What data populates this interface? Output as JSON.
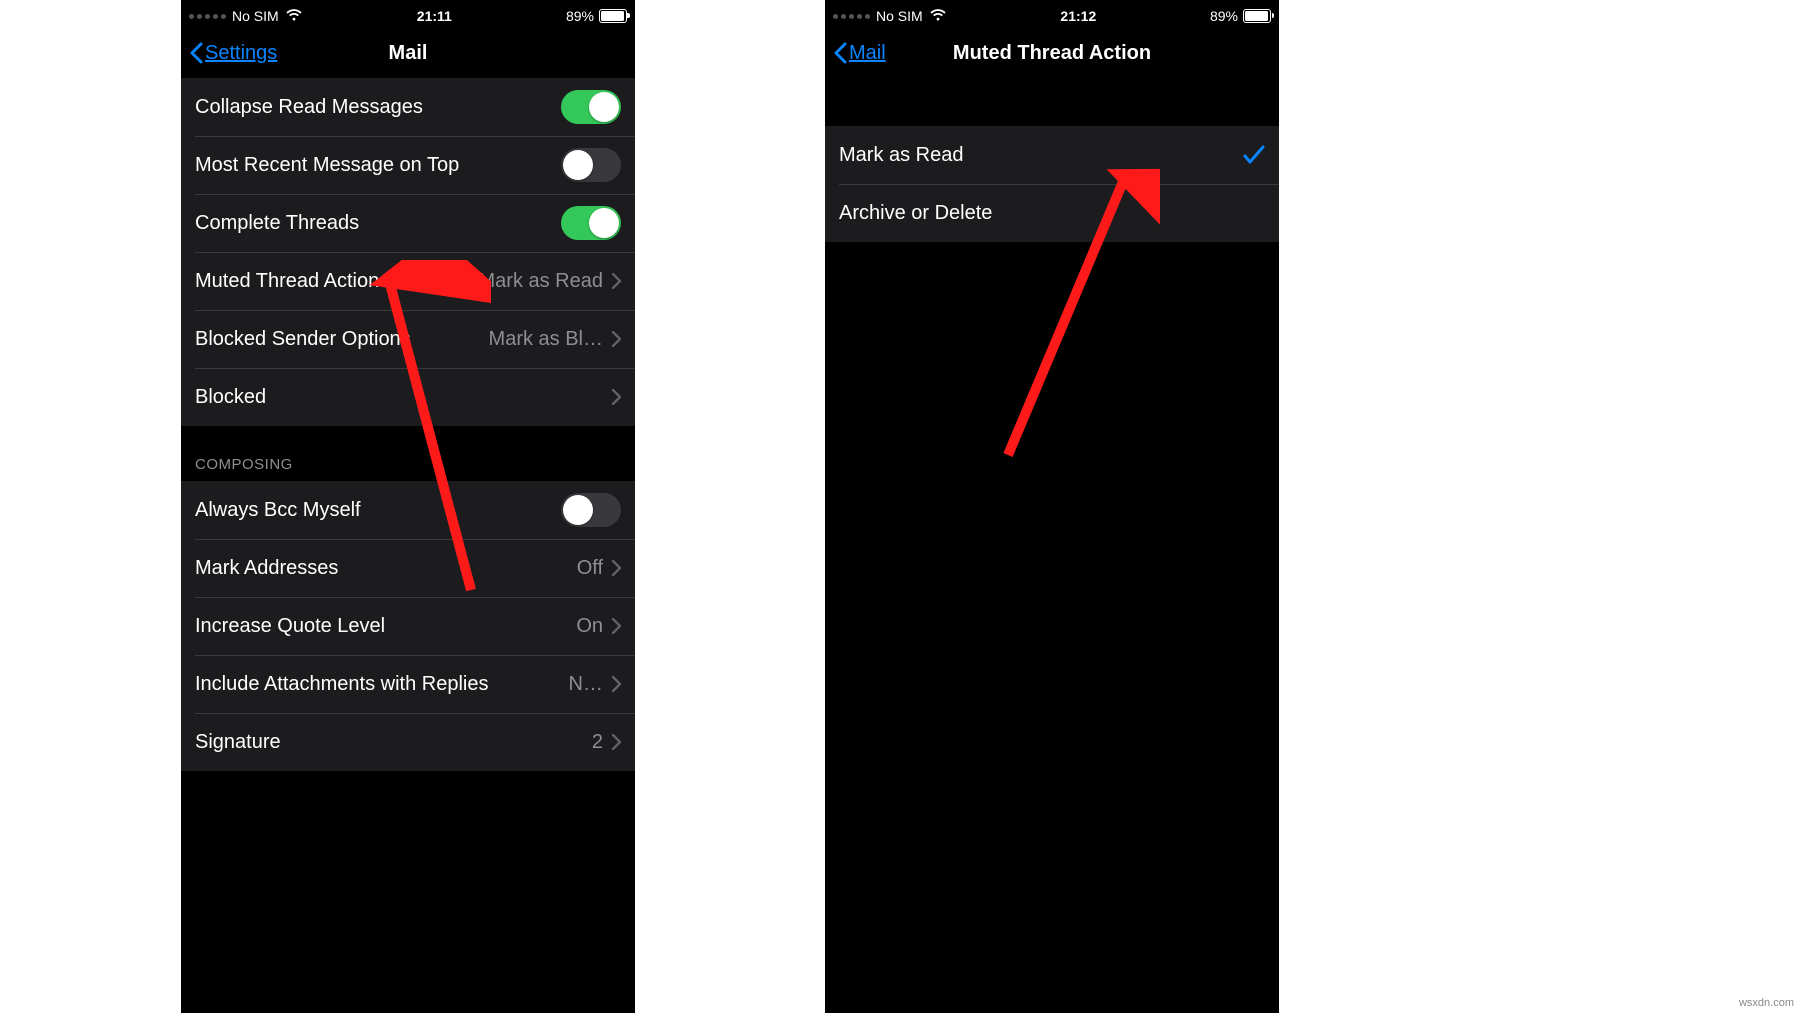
{
  "watermark": "wsxdn.com",
  "left": {
    "status": {
      "carrier": "No SIM",
      "time": "21:11",
      "battery_pct": "89%"
    },
    "nav": {
      "back": "Settings",
      "title": "Mail"
    },
    "rows": {
      "collapse": "Collapse Read Messages",
      "recent_top": "Most Recent Message on Top",
      "complete_threads": "Complete Threads",
      "muted_action": {
        "label": "Muted Thread Action",
        "value": "Mark as Read"
      },
      "blocked_sender": {
        "label": "Blocked Sender Options",
        "value": "Mark as Bl…"
      },
      "blocked": "Blocked"
    },
    "section_composing": "COMPOSING",
    "composing": {
      "always_bcc": "Always Bcc Myself",
      "mark_addresses": {
        "label": "Mark Addresses",
        "value": "Off"
      },
      "increase_quote": {
        "label": "Increase Quote Level",
        "value": "On"
      },
      "include_attachments": {
        "label": "Include Attachments with Replies",
        "value": "N…"
      },
      "signature": {
        "label": "Signature",
        "value": "2"
      }
    }
  },
  "right": {
    "status": {
      "carrier": "No SIM",
      "time": "21:12",
      "battery_pct": "89%"
    },
    "nav": {
      "back": "Mail",
      "title": "Muted Thread Action"
    },
    "options": {
      "mark_as_read": "Mark as Read",
      "archive_delete": "Archive or Delete"
    }
  }
}
